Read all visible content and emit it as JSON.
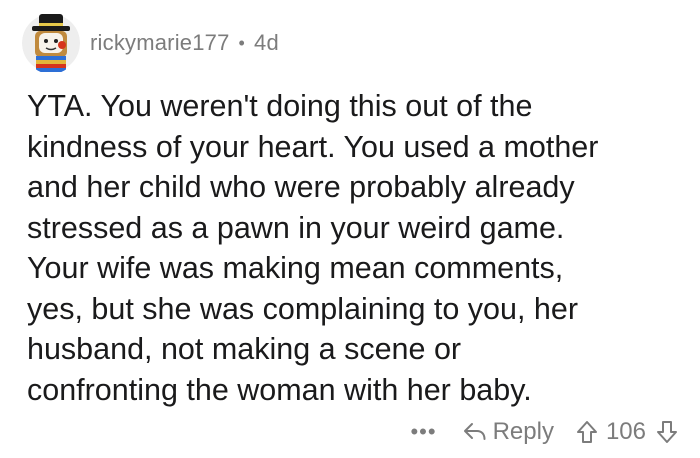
{
  "comment": {
    "username": "rickymarie177",
    "separator": "•",
    "age": "4d",
    "body_lines": [
      "YTA. You weren't doing this out of the",
      "kindness of your heart. You used a mother",
      "and her child who were probably already",
      "stressed as a pawn in your weird game.",
      "Your wife was making mean comments,",
      "yes, but she was complaining to you, her",
      "husband, not making a scene or",
      "confronting the woman with her baby."
    ]
  },
  "actions": {
    "more_label": "•••",
    "reply_label": "Reply",
    "score": "106",
    "reply_icon": "reply-arrow-icon",
    "upvote_icon": "upvote-arrow-icon",
    "downvote_icon": "downvote-arrow-icon"
  },
  "colors": {
    "text": "#1a1a1b",
    "meta": "#7c7c7c",
    "background": "#ffffff"
  }
}
